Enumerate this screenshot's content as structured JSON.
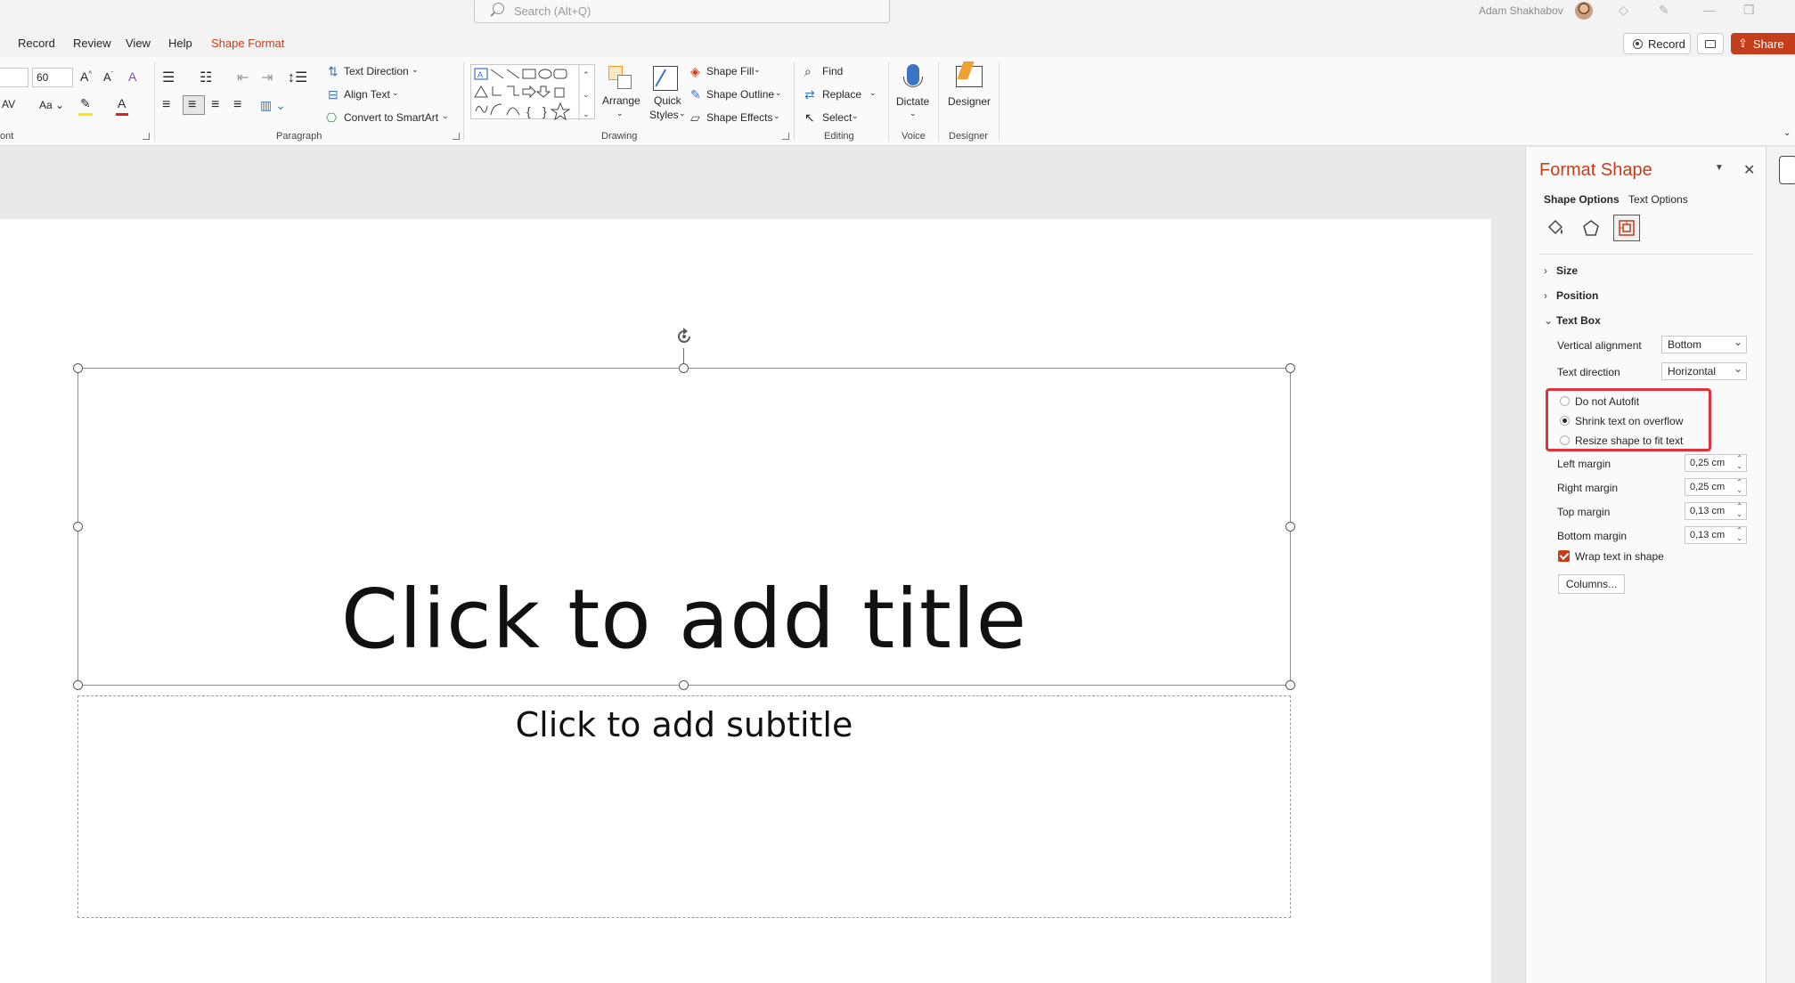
{
  "search": {
    "placeholder": "Search (Alt+Q)"
  },
  "user": {
    "name": "Adam Shakhabov"
  },
  "tabs": [
    {
      "label": "Record"
    },
    {
      "label": "Review"
    },
    {
      "label": "View"
    },
    {
      "label": "Help"
    },
    {
      "label": "Shape Format"
    }
  ],
  "header_buttons": {
    "record": "Record",
    "share": "Share"
  },
  "ribbon": {
    "font": {
      "size_value": "60",
      "group_label": "ont"
    },
    "paragraph": {
      "group_label": "Paragraph",
      "text_direction": "Text Direction",
      "align_text": "Align Text",
      "convert_smartart": "Convert to SmartArt"
    },
    "drawing": {
      "group_label": "Drawing",
      "arrange": "Arrange",
      "quick_styles_line1": "Quick",
      "quick_styles_line2": "Styles",
      "shape_fill": "Shape Fill",
      "shape_outline": "Shape Outline",
      "shape_effects": "Shape Effects"
    },
    "editing": {
      "group_label": "Editing",
      "find": "Find",
      "replace": "Replace",
      "select": "Select"
    },
    "voice": {
      "group_label": "Voice",
      "dictate": "Dictate"
    },
    "designer": {
      "group_label": "Designer",
      "designer": "Designer"
    }
  },
  "slide": {
    "title_placeholder": "Click to add title",
    "subtitle_placeholder": "Click to add subtitle"
  },
  "pane": {
    "title": "Format Shape",
    "tabs": {
      "shape_options": "Shape Options",
      "text_options": "Text Options"
    },
    "sections": {
      "size": "Size",
      "position": "Position",
      "text_box": "Text Box"
    },
    "vertical_alignment": {
      "label": "Vertical alignment",
      "value": "Bottom"
    },
    "text_direction": {
      "label": "Text direction",
      "value": "Horizontal"
    },
    "autofit": [
      {
        "label": "Do not Autofit",
        "selected": false
      },
      {
        "label": "Shrink text on overflow",
        "selected": true
      },
      {
        "label": "Resize shape to fit text",
        "selected": false
      }
    ],
    "margins": {
      "left": {
        "label": "Left margin",
        "value": "0,25 cm"
      },
      "right": {
        "label": "Right margin",
        "value": "0,25 cm"
      },
      "top": {
        "label": "Top margin",
        "value": "0,13 cm"
      },
      "bottom": {
        "label": "Bottom margin",
        "value": "0,13 cm"
      }
    },
    "wrap_text": {
      "label": "Wrap text in shape",
      "checked": true
    },
    "columns_button": "Columns..."
  },
  "colors": {
    "accent": "#c43e1c",
    "highlight": "#e0323a"
  }
}
